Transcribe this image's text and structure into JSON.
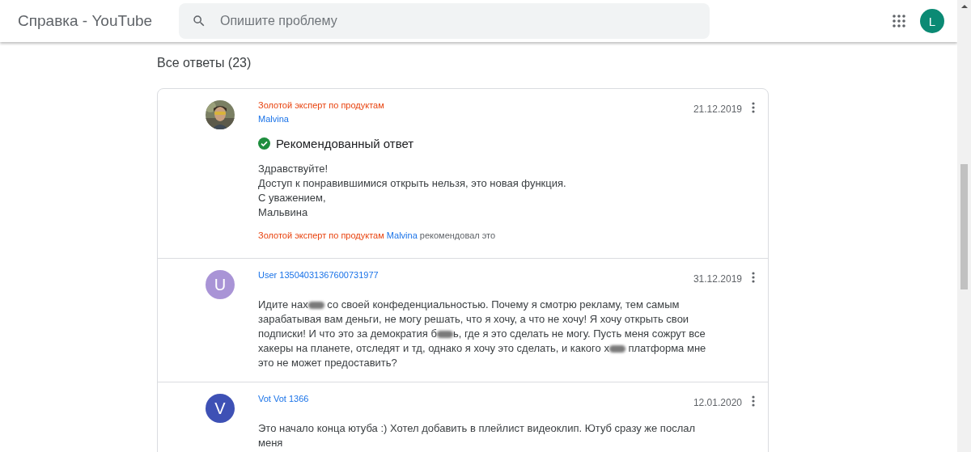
{
  "header": {
    "title": "Справка - YouTube",
    "search": {
      "placeholder": "Опишите проблему"
    },
    "account": {
      "initial": "L",
      "color": "#0b8a74"
    }
  },
  "answers_heading": "Все ответы (23)",
  "answers": [
    {
      "badge": "Золотой эксперт по продуктам",
      "author": "Malvina",
      "date": "21.12.2019",
      "recommended": {
        "label": "Рекомендованный ответ",
        "badge": "Золотой эксперт по продуктам",
        "author": "Malvina",
        "suffix": "рекомендовал это"
      },
      "lines": [
        [
          {
            "text": "Здравствуйте!"
          }
        ],
        [
          {
            "text": "Доступ к понравившимися открыть нельзя, это новая функция."
          }
        ],
        [
          {
            "text": "С уважением,"
          }
        ],
        [
          {
            "text": "Мальвина"
          }
        ]
      ]
    },
    {
      "avatar": {
        "kind": "letter",
        "initial": "U",
        "color": "#a994d6"
      },
      "author": "User 13504031367600731977",
      "date": "31.12.2019",
      "lines": [
        [
          {
            "text": "Идите нах"
          },
          {
            "kind": "blur"
          },
          {
            "text": " со своей конфеденциальностью. Почему я смотрю рекламу, тем самым зарабатывая вам деньги, не могу решать, что я хочу, а что не хочу! Я хочу открыть свои подписки! И что это за демократия б"
          },
          {
            "kind": "blur"
          },
          {
            "text": "ь, где я это сделать не могу. Пусть меня сожрут все хакеры на планете, отследят и тд, однако я хочу это сделать, и какого х"
          },
          {
            "kind": "blur"
          },
          {
            "text": " платформа мне это не может предоставить?"
          }
        ]
      ]
    },
    {
      "avatar": {
        "kind": "letter",
        "initial": "V",
        "color": "#3e51b5"
      },
      "author": "Vot Vot 1366",
      "date": "12.01.2020",
      "lines": [
        [
          {
            "text": "Это начало конца ютуба :) Хотел добавить в плейлист видеоклип. Ютуб сразу же послал меня"
          }
        ]
      ]
    }
  ]
}
